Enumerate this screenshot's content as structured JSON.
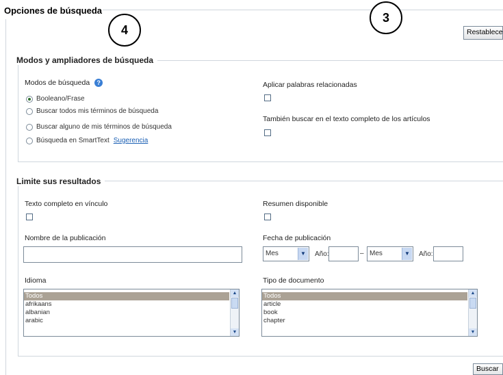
{
  "header": {
    "title": "Opciones de búsqueda",
    "reset_label": "Restablecer"
  },
  "badges": {
    "left": "4",
    "right": "3"
  },
  "modes_section": {
    "title": "Modos y ampliadores de búsqueda",
    "modes_label": "Modos de búsqueda",
    "help_icon": "question-icon",
    "options": [
      {
        "label": "Booleano/Frase",
        "selected": true
      },
      {
        "label": "Buscar todos mis términos de búsqueda",
        "selected": false
      },
      {
        "label": "Buscar alguno de mis términos de búsqueda",
        "selected": false
      },
      {
        "label": "Búsqueda en SmartText",
        "selected": false
      }
    ],
    "hint_link": "Sugerencia",
    "related_words_label": "Aplicar palabras relacionadas",
    "fulltext_search_label": "También buscar en el texto completo de los artículos"
  },
  "limits_section": {
    "title": "Limite sus resultados",
    "fulltext_link_label": "Texto completo en vínculo",
    "abstract_label": "Resumen disponible",
    "publication_name_label": "Nombre de la publicación",
    "publication_name_value": "",
    "publication_date_label": "Fecha de publicación",
    "month_from": "Mes",
    "year_label": "Año:",
    "dash": "–",
    "month_to": "Mes",
    "language_label": "Idioma",
    "languages": [
      "Todos",
      "afrikaans",
      "albanian",
      "arabic"
    ],
    "doctype_label": "Tipo de documento",
    "doctypes": [
      "Todos",
      "article",
      "book",
      "chapter"
    ]
  },
  "footer": {
    "search_label": "Buscar"
  }
}
